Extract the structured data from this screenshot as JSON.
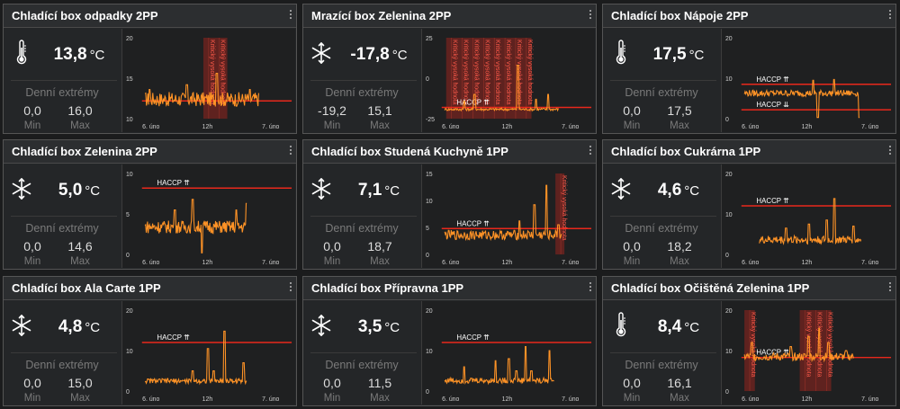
{
  "colors": {
    "series": "#ff9326",
    "threshold": "#e8281c",
    "alert_band": "rgba(200,40,30,0.38)"
  },
  "extremes_label": "Denní extrémy",
  "min_label": "Min",
  "max_label": "Max",
  "x_ticks": [
    "6. úno",
    "12h",
    "7. úno"
  ],
  "panels": [
    {
      "title": "Chladící box odpadky 2PP",
      "icon": "thermometer-icon",
      "temp": "13,8",
      "unit": "°C",
      "min": "0,0",
      "max": "16,0",
      "chart_data": {
        "type": "line",
        "ylim": [
          10,
          20
        ],
        "yticks": [
          "20",
          "15",
          "10"
        ],
        "x_ticks": [
          "6. úno",
          "12h",
          "7. úno"
        ],
        "thresholds": [
          {
            "y": 12.2,
            "label": ""
          }
        ],
        "alerts": [
          {
            "x0": 0.41,
            "x1": 0.57,
            "label": "Kritický vysoká hodnota"
          }
        ],
        "series": [
          {
            "start": 0.02,
            "end": 0.78,
            "base": 12.4,
            "noise": 0.9,
            "spikes": [
              [
                0.05,
                13.6
              ],
              [
                0.3,
                14.2
              ],
              [
                0.5,
                15.6
              ],
              [
                0.72,
                13.6
              ]
            ]
          }
        ]
      }
    },
    {
      "title": "Mrazící box Zelenina 2PP",
      "icon": "snowflake-icon",
      "temp": "-17,8",
      "unit": "°C",
      "min": "-19,2",
      "max": "15,1",
      "chart_data": {
        "type": "line",
        "ylim": [
          -25,
          25
        ],
        "yticks": [
          "25",
          "0",
          "-25"
        ],
        "x_ticks": [
          "6. úno",
          "12h",
          "7. úno"
        ],
        "thresholds": [
          {
            "y": -18,
            "label": "HACCP ⇈"
          }
        ],
        "alerts": [
          {
            "x0": 0.03,
            "x1": 0.6,
            "label": "Kritický vysoká hodnota"
          }
        ],
        "series": [
          {
            "start": 0.02,
            "end": 0.78,
            "base": -19.2,
            "noise": 0.8,
            "spikes": [
              [
                0.15,
                -14
              ],
              [
                0.22,
                -10
              ],
              [
                0.51,
                8
              ],
              [
                0.63,
                -13
              ],
              [
                0.71,
                -10
              ]
            ]
          }
        ]
      }
    },
    {
      "title": "Chladící box Nápoje 2PP",
      "icon": "thermometer-icon",
      "temp": "17,5",
      "unit": "°C",
      "min": "0,0",
      "max": "17,5",
      "chart_data": {
        "type": "line",
        "ylim": [
          0,
          20
        ],
        "yticks": [
          "20",
          "10",
          "0"
        ],
        "x_ticks": [
          "6. úno",
          "12h",
          "7. úno"
        ],
        "thresholds": [
          {
            "y": 8.5,
            "label": "HACCP ⇈"
          },
          {
            "y": 2.2,
            "label": "HACCP ⇊"
          }
        ],
        "alerts": [],
        "series": [
          {
            "start": 0.02,
            "end": 0.79,
            "base": 6.3,
            "noise": 0.8,
            "spikes": [
              [
                0.48,
                9.5
              ],
              [
                0.51,
                0.3
              ],
              [
                0.62,
                9.7
              ],
              [
                0.79,
                0.3
              ]
            ]
          }
        ]
      }
    },
    {
      "title": "Chladící box Zelenina 2PP",
      "icon": "snowflake-icon",
      "temp": "5,0",
      "unit": "°C",
      "min": "0,0",
      "max": "14,6",
      "chart_data": {
        "type": "line",
        "ylim": [
          0,
          10
        ],
        "yticks": [
          "10",
          "5",
          "0"
        ],
        "x_ticks": [
          "6. úno",
          "12h",
          "7. úno"
        ],
        "thresholds": [
          {
            "y": 8.2,
            "label": "HACCP ⇈"
          }
        ],
        "alerts": [],
        "series": [
          {
            "start": 0.02,
            "end": 0.7,
            "base": 3.4,
            "noise": 0.8,
            "spikes": [
              [
                0.22,
                5.5
              ],
              [
                0.34,
                6.8
              ],
              [
                0.4,
                0.2
              ],
              [
                0.63,
                5.5
              ],
              [
                0.7,
                6.3
              ]
            ]
          }
        ]
      }
    },
    {
      "title": "Chladící box Studená Kuchyně 1PP",
      "icon": "snowflake-icon",
      "temp": "7,1",
      "unit": "°C",
      "min": "0,0",
      "max": "18,7",
      "chart_data": {
        "type": "line",
        "ylim": [
          0,
          15
        ],
        "yticks": [
          "15",
          "10",
          "5",
          "0"
        ],
        "x_ticks": [
          "6. úno",
          "12h",
          "7. úno"
        ],
        "thresholds": [
          {
            "y": 4.8,
            "label": "HACCP ⇈"
          }
        ],
        "alerts": [
          {
            "x0": 0.76,
            "x1": 0.82,
            "label": "Kritický vysoká hodnota"
          }
        ],
        "series": [
          {
            "start": 0.02,
            "end": 0.8,
            "base": 3.6,
            "noise": 0.9,
            "spikes": [
              [
                0.52,
                6.2
              ],
              [
                0.62,
                9.2
              ],
              [
                0.7,
                12.8
              ],
              [
                0.78,
                5.5
              ]
            ]
          }
        ]
      }
    },
    {
      "title": "Chladící box Cukrárna 1PP",
      "icon": "snowflake-icon",
      "temp": "4,6",
      "unit": "°C",
      "min": "0,0",
      "max": "18,2",
      "chart_data": {
        "type": "line",
        "ylim": [
          0,
          20
        ],
        "yticks": [
          "20",
          "10",
          "0"
        ],
        "x_ticks": [
          "6. úno",
          "12h",
          "7. úno"
        ],
        "thresholds": [
          {
            "y": 12,
            "label": "HACCP ⇈"
          }
        ],
        "alerts": [],
        "series": [
          {
            "start": 0.12,
            "end": 0.8,
            "base": 3.6,
            "noise": 1.0,
            "spikes": [
              [
                0.3,
                6.5
              ],
              [
                0.45,
                7.5
              ],
              [
                0.57,
                8.5
              ],
              [
                0.62,
                13.8
              ],
              [
                0.75,
                7
              ]
            ]
          }
        ]
      }
    },
    {
      "title": "Chladící box Ala Carte 1PP",
      "icon": "snowflake-icon",
      "temp": "4,8",
      "unit": "°C",
      "min": "0,0",
      "max": "15,0",
      "chart_data": {
        "type": "line",
        "ylim": [
          0,
          20
        ],
        "yticks": [
          "20",
          "10",
          "0"
        ],
        "x_ticks": [
          "6. úno",
          "12h",
          "7. úno"
        ],
        "thresholds": [
          {
            "y": 12,
            "label": "HACCP ⇈"
          }
        ],
        "alerts": [],
        "series": [
          {
            "start": 0.02,
            "end": 0.7,
            "base": 2.5,
            "noise": 0.6,
            "spikes": [
              [
                0.34,
                5
              ],
              [
                0.44,
                10.5
              ],
              [
                0.48,
                5
              ],
              [
                0.55,
                14.8
              ],
              [
                0.68,
                7
              ]
            ]
          }
        ]
      }
    },
    {
      "title": "Chladící box Přípravna 1PP",
      "icon": "snowflake-icon",
      "temp": "3,5",
      "unit": "°C",
      "min": "0,0",
      "max": "11,5",
      "chart_data": {
        "type": "line",
        "ylim": [
          0,
          20
        ],
        "yticks": [
          "20",
          "10",
          "0"
        ],
        "x_ticks": [
          "6. úno",
          "12h",
          "7. úno"
        ],
        "thresholds": [
          {
            "y": 12,
            "label": "HACCP ⇈"
          }
        ],
        "alerts": [],
        "series": [
          {
            "start": 0.02,
            "end": 0.75,
            "base": 2.6,
            "noise": 0.7,
            "spikes": [
              [
                0.15,
                6
              ],
              [
                0.36,
                7.5
              ],
              [
                0.45,
                8
              ],
              [
                0.5,
                5
              ],
              [
                0.56,
                11
              ],
              [
                0.6,
                5
              ],
              [
                0.72,
                10
              ]
            ]
          }
        ]
      }
    },
    {
      "title": "Chladící box Očištěná Zelenina 1PP",
      "icon": "thermometer-icon",
      "temp": "8,4",
      "unit": "°C",
      "min": "0,0",
      "max": "16,1",
      "chart_data": {
        "type": "line",
        "ylim": [
          0,
          20
        ],
        "yticks": [
          "20",
          "10",
          "0"
        ],
        "x_ticks": [
          "6. úno",
          "12h",
          "7. úno"
        ],
        "thresholds": [
          {
            "y": 8.3,
            "label": "HACCP ⇈"
          }
        ],
        "alerts": [
          {
            "x0": 0.02,
            "x1": 0.09,
            "label": "Kritický vysoká hodnota"
          },
          {
            "x0": 0.39,
            "x1": 0.6,
            "label": "Kritický vysoká hodnota"
          }
        ],
        "series": [
          {
            "start": 0.02,
            "end": 0.75,
            "base": 8.5,
            "noise": 1.0,
            "spikes": [
              [
                0.07,
                12
              ],
              [
                0.33,
                11
              ],
              [
                0.45,
                13.5
              ],
              [
                0.52,
                15.5
              ],
              [
                0.58,
                12
              ],
              [
                0.7,
                10
              ]
            ]
          }
        ]
      }
    }
  ]
}
